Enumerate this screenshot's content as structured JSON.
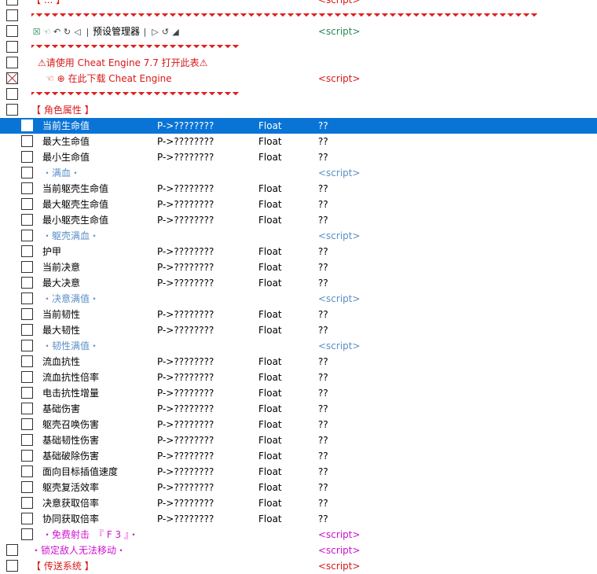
{
  "rows": {
    "r0": {
      "label": "【 ... 】",
      "value": "<script>"
    },
    "r2": {
      "label": "预设管理器",
      "value": "<script>"
    },
    "r4": {
      "label": "请使用 Cheat Engine 7.7 打开此表",
      "value": ""
    },
    "r5": {
      "label": "在此下载 Cheat Engine",
      "value": "<script>"
    },
    "r7": {
      "label": "【 角色属性 】"
    },
    "r8": {
      "label": "当前生命值",
      "addr": "P->????????",
      "type": "Float",
      "value": "??"
    },
    "r9": {
      "label": "最大生命值",
      "addr": "P->????????",
      "type": "Float",
      "value": "??"
    },
    "r10": {
      "label": "最小生命值",
      "addr": "P->????????",
      "type": "Float",
      "value": "??"
    },
    "r11": {
      "label": "・满血・",
      "value": "<script>"
    },
    "r12": {
      "label": "当前躯壳生命值",
      "addr": "P->????????",
      "type": "Float",
      "value": "??"
    },
    "r13": {
      "label": "最大躯壳生命值",
      "addr": "P->????????",
      "type": "Float",
      "value": "??"
    },
    "r14": {
      "label": "最小躯壳生命值",
      "addr": "P->????????",
      "type": "Float",
      "value": "??"
    },
    "r15": {
      "label": "・躯壳满血・",
      "value": "<script>"
    },
    "r16": {
      "label": "护甲",
      "addr": "P->????????",
      "type": "Float",
      "value": "??"
    },
    "r17": {
      "label": "当前决意",
      "addr": "P->????????",
      "type": "Float",
      "value": "??"
    },
    "r18": {
      "label": "最大决意",
      "addr": "P->????????",
      "type": "Float",
      "value": "??"
    },
    "r19": {
      "label": "・决意满值・",
      "value": "<script>"
    },
    "r20": {
      "label": "当前韧性",
      "addr": "P->????????",
      "type": "Float",
      "value": "??"
    },
    "r21": {
      "label": "最大韧性",
      "addr": "P->????????",
      "type": "Float",
      "value": "??"
    },
    "r22": {
      "label": "・韧性满值・",
      "value": "<script>"
    },
    "r23": {
      "label": "流血抗性",
      "addr": "P->????????",
      "type": "Float",
      "value": "??"
    },
    "r24": {
      "label": "流血抗性倍率",
      "addr": "P->????????",
      "type": "Float",
      "value": "??"
    },
    "r25": {
      "label": "电击抗性增量",
      "addr": "P->????????",
      "type": "Float",
      "value": "??"
    },
    "r26": {
      "label": "基础伤害",
      "addr": "P->????????",
      "type": "Float",
      "value": "??"
    },
    "r27": {
      "label": "躯壳召唤伤害",
      "addr": "P->????????",
      "type": "Float",
      "value": "??"
    },
    "r28": {
      "label": "基础韧性伤害",
      "addr": "P->????????",
      "type": "Float",
      "value": "??"
    },
    "r29": {
      "label": "基础破除伤害",
      "addr": "P->????????",
      "type": "Float",
      "value": "??"
    },
    "r30": {
      "label": "面向目标插值速度",
      "addr": "P->????????",
      "type": "Float",
      "value": "??"
    },
    "r31": {
      "label": "躯壳复活效率",
      "addr": "P->????????",
      "type": "Float",
      "value": "??"
    },
    "r32": {
      "label": "决意获取倍率",
      "addr": "P->????????",
      "type": "Float",
      "value": "??"
    },
    "r33": {
      "label": "协同获取倍率",
      "addr": "P->????????",
      "type": "Float",
      "value": "??"
    },
    "r34": {
      "label": "・免费射击　『 F 3 』・",
      "value": "<script>"
    },
    "r35": {
      "label": "・锁定敌人无法移动・",
      "value": "<script>"
    },
    "r36": {
      "label": "【 传送系统 】",
      "value": "<script>"
    }
  }
}
